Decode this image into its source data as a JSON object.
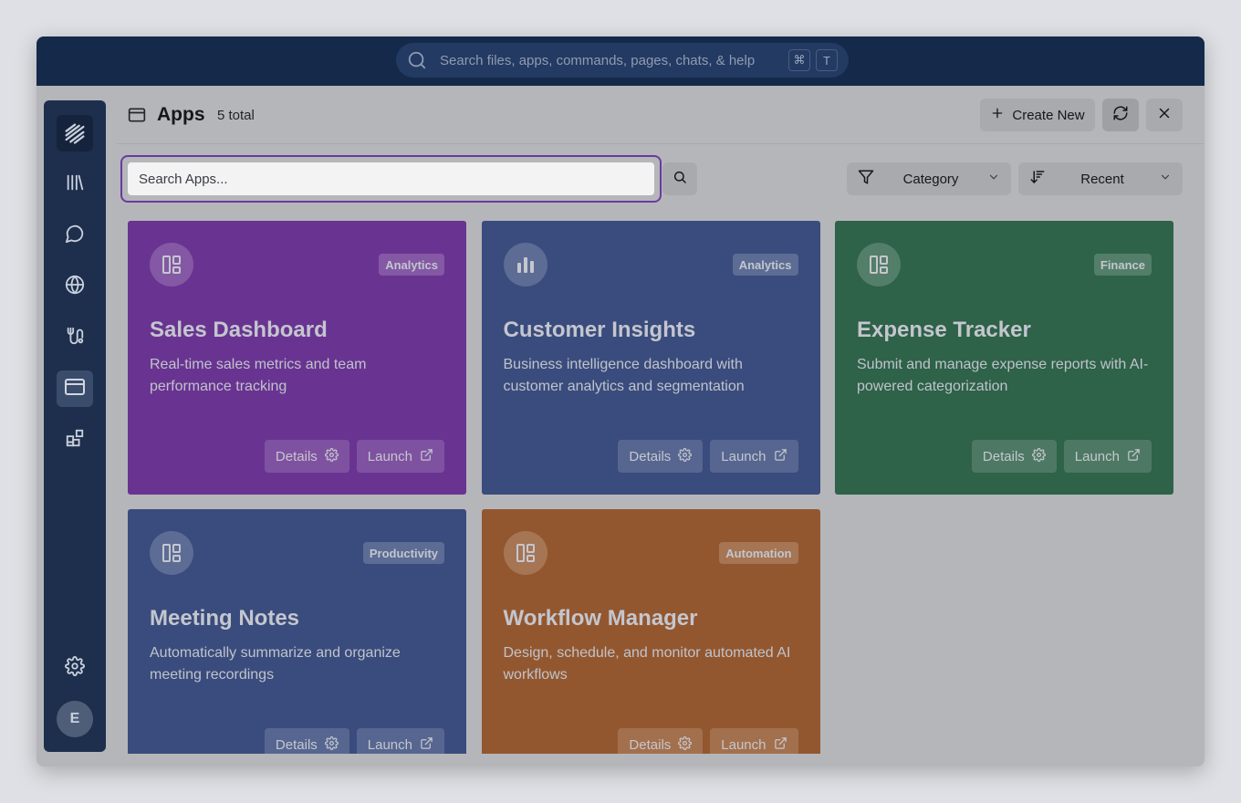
{
  "topbar": {
    "search_placeholder": "Search files, apps, commands, pages, chats, & help",
    "shortcut_keys": [
      "⌘",
      "T"
    ]
  },
  "sidebar": {
    "items": [
      {
        "name": "logo",
        "icon": "logo-icon"
      },
      {
        "name": "library",
        "icon": "library-icon"
      },
      {
        "name": "chat",
        "icon": "chat-icon"
      },
      {
        "name": "globe",
        "icon": "globe-icon"
      },
      {
        "name": "workflows",
        "icon": "route-icon"
      },
      {
        "name": "apps",
        "icon": "app-window-icon",
        "active": true
      },
      {
        "name": "integrations",
        "icon": "blocks-icon"
      },
      {
        "name": "settings",
        "icon": "gear-icon"
      }
    ],
    "avatar_initial": "E"
  },
  "header": {
    "title": "Apps",
    "count": "5 total",
    "create_label": "Create New"
  },
  "toolbar": {
    "search_placeholder": "Search Apps...",
    "category_label": "Category",
    "sort_label": "Recent"
  },
  "cards": [
    {
      "title": "Sales Dashboard",
      "badge": "Analytics",
      "desc": "Real-time sales metrics and team performance tracking",
      "color": "#693491",
      "icon": "layout-icon",
      "details": "Details",
      "launch": "Launch"
    },
    {
      "title": "Customer Insights",
      "badge": "Analytics",
      "desc": "Business intelligence dashboard with customer analytics and segmentation",
      "color": "#3a4c7d",
      "icon": "bar-chart-icon",
      "details": "Details",
      "launch": "Launch"
    },
    {
      "title": "Expense Tracker",
      "badge": "Finance",
      "desc": "Submit and manage expense reports with AI-powered categorization",
      "color": "#2e6249",
      "icon": "layout-icon",
      "details": "Details",
      "launch": "Launch"
    },
    {
      "title": "Meeting Notes",
      "badge": "Productivity",
      "desc": "Automatically summarize and organize meeting recordings",
      "color": "#3a4c7d",
      "icon": "layout-icon",
      "details": "Details",
      "launch": "Launch"
    },
    {
      "title": "Workflow Manager",
      "badge": "Automation",
      "desc": "Design, schedule, and monitor automated AI workflows",
      "color": "#93572f",
      "icon": "layout-icon",
      "details": "Details",
      "launch": "Launch"
    }
  ]
}
